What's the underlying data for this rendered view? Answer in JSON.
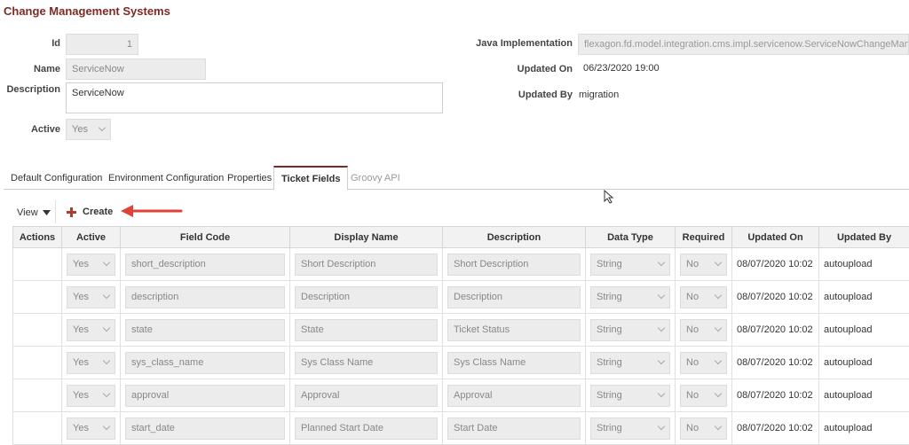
{
  "page": {
    "title": "Change Management Systems"
  },
  "form": {
    "id_label": "Id",
    "id_value": "1",
    "name_label": "Name",
    "name_value": "ServiceNow",
    "description_label": "Description",
    "description_value": "ServiceNow",
    "active_label": "Active",
    "active_value": "Yes",
    "java_impl_label": "Java Implementation",
    "java_impl_value": "flexagon.fd.model.integration.cms.impl.servicenow.ServiceNowChangeManagement",
    "updated_on_label": "Updated On",
    "updated_on_value": "06/23/2020 19:00",
    "updated_by_label": "Updated By",
    "updated_by_value": "migration"
  },
  "tabs": [
    {
      "label": "Default Configuration",
      "active": false
    },
    {
      "label": "Environment Configuration",
      "active": false
    },
    {
      "label": "Properties",
      "active": false
    },
    {
      "label": "Ticket Fields",
      "active": true
    },
    {
      "label": "Groovy API",
      "active": false,
      "disabled": true
    }
  ],
  "toolbar": {
    "view_label": "View",
    "create_label": "Create",
    "accent": "#b03a2e",
    "arrow_color": "#e0423a"
  },
  "table": {
    "columns": [
      "Actions",
      "Active",
      "Field Code",
      "Display Name",
      "Description",
      "Data Type",
      "Required",
      "Updated On",
      "Updated By"
    ],
    "rows": [
      {
        "active": "Yes",
        "field_code": "short_description",
        "display_name": "Short Description",
        "description": "Short Description",
        "data_type": "String",
        "required": "No",
        "updated_on": "08/07/2020 10:02",
        "updated_by": "autoupload"
      },
      {
        "active": "Yes",
        "field_code": "description",
        "display_name": "Description",
        "description": "Description",
        "data_type": "String",
        "required": "No",
        "updated_on": "08/07/2020 10:02",
        "updated_by": "autoupload"
      },
      {
        "active": "Yes",
        "field_code": "state",
        "display_name": "State",
        "description": "Ticket Status",
        "data_type": "String",
        "required": "No",
        "updated_on": "08/07/2020 10:02",
        "updated_by": "autoupload"
      },
      {
        "active": "Yes",
        "field_code": "sys_class_name",
        "display_name": "Sys Class Name",
        "description": "Sys Class Name",
        "data_type": "String",
        "required": "No",
        "updated_on": "08/07/2020 10:02",
        "updated_by": "autoupload"
      },
      {
        "active": "Yes",
        "field_code": "approval",
        "display_name": "Approval",
        "description": "Approval",
        "data_type": "String",
        "required": "No",
        "updated_on": "08/07/2020 10:02",
        "updated_by": "autoupload"
      },
      {
        "active": "Yes",
        "field_code": "start_date",
        "display_name": "Planned Start Date",
        "description": "Start Date",
        "data_type": "String",
        "required": "No",
        "updated_on": "08/07/2020 10:02",
        "updated_by": "autoupload"
      }
    ]
  }
}
